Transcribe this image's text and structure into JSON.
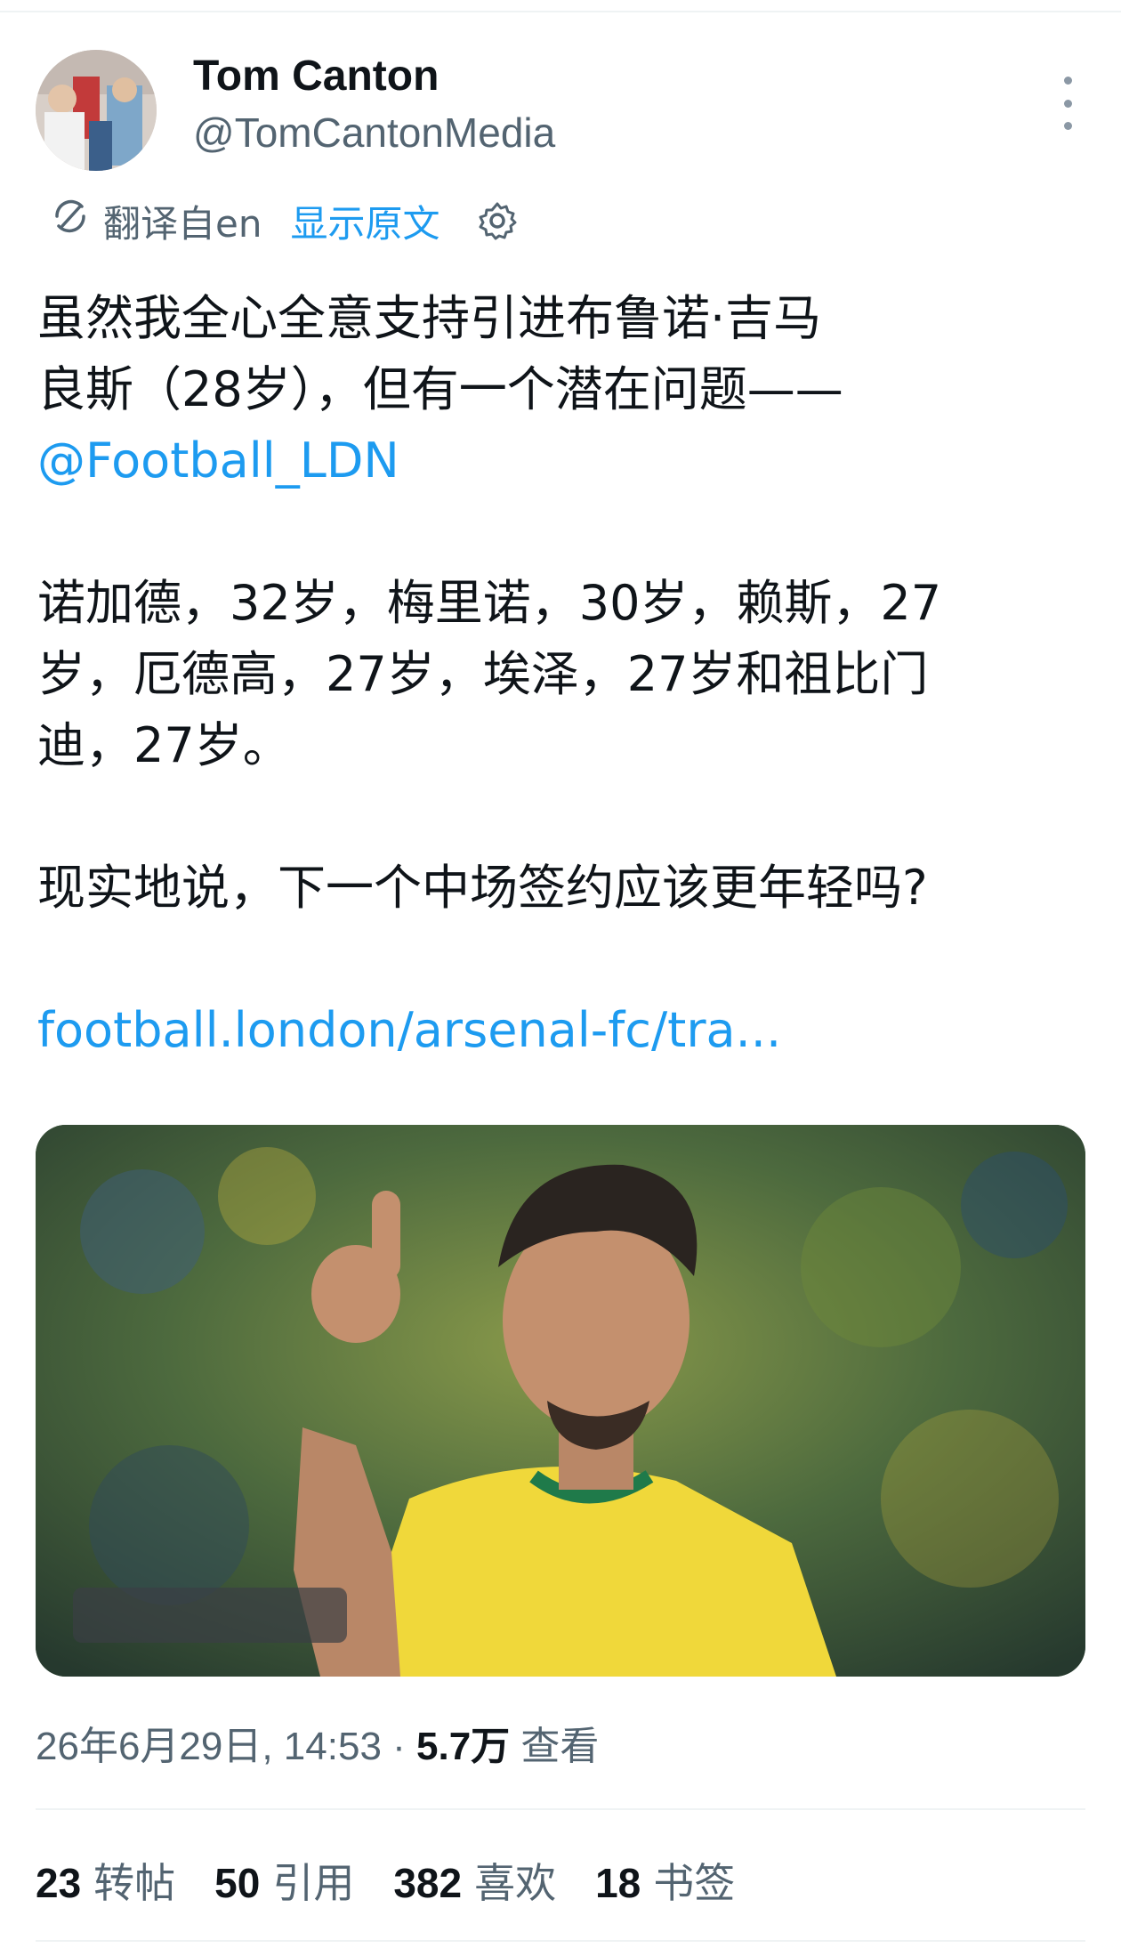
{
  "author": {
    "name": "Tom Canton",
    "handle": "@TomCantonMedia"
  },
  "translation": {
    "label": "翻译自en",
    "show_original": "显示原文"
  },
  "tweet": {
    "line1": "虽然我全心全意支持引进布鲁诺·吉马",
    "line2": "良斯（28岁），但有一个潜在问题——",
    "mention": "@Football_LDN",
    "para2_line1": "诺加德，32岁，梅里诺，30岁，赖斯，27",
    "para2_line2": "岁，厄德高，27岁，埃泽，27岁和祖比门",
    "para2_line3": "迪，27岁。",
    "para3": "现实地说，下一个中场签约应该更年轻吗?",
    "link": "football.london/arsenal-fc/tra..."
  },
  "meta": {
    "timestamp": "26年6月29日, 14:53 · ",
    "views_count": "5.7万",
    "views_label": " 查看"
  },
  "stats": {
    "reposts": {
      "count": "23",
      "label": "转帖"
    },
    "quotes": {
      "count": "50",
      "label": "引用"
    },
    "likes": {
      "count": "382",
      "label": "喜欢"
    },
    "bookmarks": {
      "count": "18",
      "label": "书签"
    }
  },
  "colors": {
    "link": "#1d9bf0",
    "secondary_text": "#536471",
    "primary_text": "#0f1419"
  },
  "icons": [
    "more-vertical-icon",
    "translate-icon",
    "gear-icon"
  ]
}
